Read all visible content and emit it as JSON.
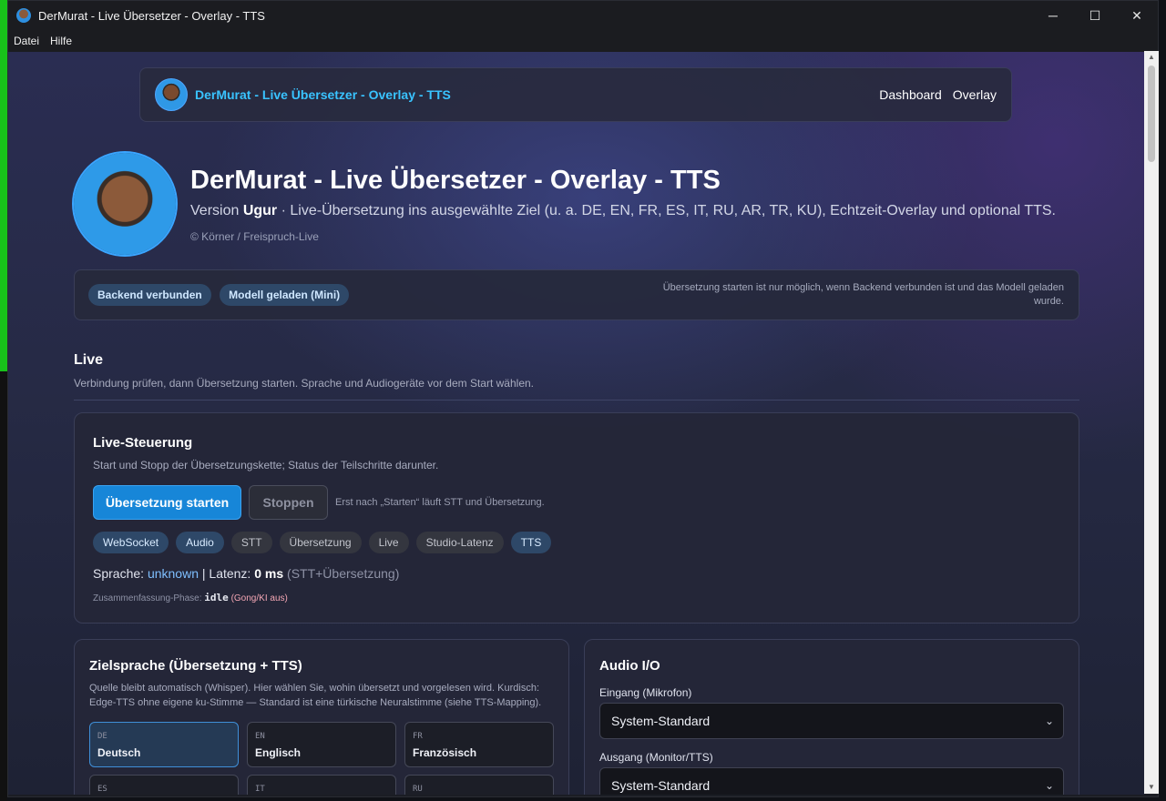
{
  "window": {
    "title": "DerMurat - Live Übersetzer - Overlay - TTS",
    "minimize": "─",
    "maximize": "☐",
    "close": "✕"
  },
  "menu": [
    "Datei",
    "Hilfe"
  ],
  "navbar": {
    "brand": "DerMurat - Live Übersetzer - Overlay - TTS",
    "links": [
      "Dashboard",
      "Overlay"
    ]
  },
  "hero": {
    "title": "DerMurat - Live Übersetzer - Overlay - TTS",
    "version_prefix": "Version",
    "version": "Ugur",
    "subtitle_rest": "· Live-Übersetzung ins ausgewählte Ziel (u. a. DE, EN, FR, ES, IT, RU, AR, TR, KU), Echtzeit-Overlay und optional TTS.",
    "copyright": "© Körner / Freispruch-Live"
  },
  "status": {
    "badges": [
      "Backend verbunden",
      "Modell geladen (Mini)"
    ],
    "hint": "Übersetzung starten ist nur möglich, wenn Backend verbunden ist und das Modell geladen wurde."
  },
  "live_section": {
    "title": "Live",
    "description": "Verbindung prüfen, dann Übersetzung starten. Sprache und Audiogeräte vor dem Start wählen."
  },
  "live_control": {
    "title": "Live-Steuerung",
    "description": "Start und Stopp der Übersetzungskette; Status der Teilschritte darunter.",
    "start_label": "Übersetzung starten",
    "stop_label": "Stoppen",
    "hint": "Erst nach „Starten“ läuft STT und Übersetzung.",
    "steps": [
      {
        "label": "WebSocket",
        "active": true
      },
      {
        "label": "Audio",
        "active": true
      },
      {
        "label": "STT",
        "active": false
      },
      {
        "label": "Übersetzung",
        "active": false
      },
      {
        "label": "Live",
        "active": false
      },
      {
        "label": "Studio-Latenz",
        "active": false
      },
      {
        "label": "TTS",
        "active": true
      }
    ],
    "language_label": "Sprache:",
    "language_value": "unknown",
    "latency_label": "| Latenz:",
    "latency_value": "0 ms",
    "latency_note": "(STT+Übersetzung)",
    "phase_label": "Zusammenfassung-Phase:",
    "phase_value": "idle",
    "phase_note": "(Gong/KI aus)"
  },
  "target_language": {
    "title": "Zielsprache (Übersetzung + TTS)",
    "description": "Quelle bleibt automatisch (Whisper). Hier wählen Sie, wohin übersetzt und vorgelesen wird. Kurdisch: Edge-TTS ohne eigene ku-Stimme — Standard ist eine türkische Neuralstimme (siehe TTS-Mapping).",
    "options": [
      {
        "code": "DE",
        "name": "Deutsch",
        "selected": true
      },
      {
        "code": "EN",
        "name": "Englisch",
        "selected": false
      },
      {
        "code": "FR",
        "name": "Französisch",
        "selected": false
      },
      {
        "code": "ES",
        "name": "",
        "selected": false
      },
      {
        "code": "IT",
        "name": "",
        "selected": false
      },
      {
        "code": "RU",
        "name": "",
        "selected": false
      }
    ]
  },
  "audio_io": {
    "title": "Audio I/O",
    "input_label": "Eingang (Mikrofon)",
    "input_value": "System-Standard",
    "output_label": "Ausgang (Monitor/TTS)",
    "output_value": "System-Standard"
  },
  "colors": {
    "accent": "#1786d8",
    "brand": "#39c3ff",
    "badge_bg": "#2e4868"
  }
}
